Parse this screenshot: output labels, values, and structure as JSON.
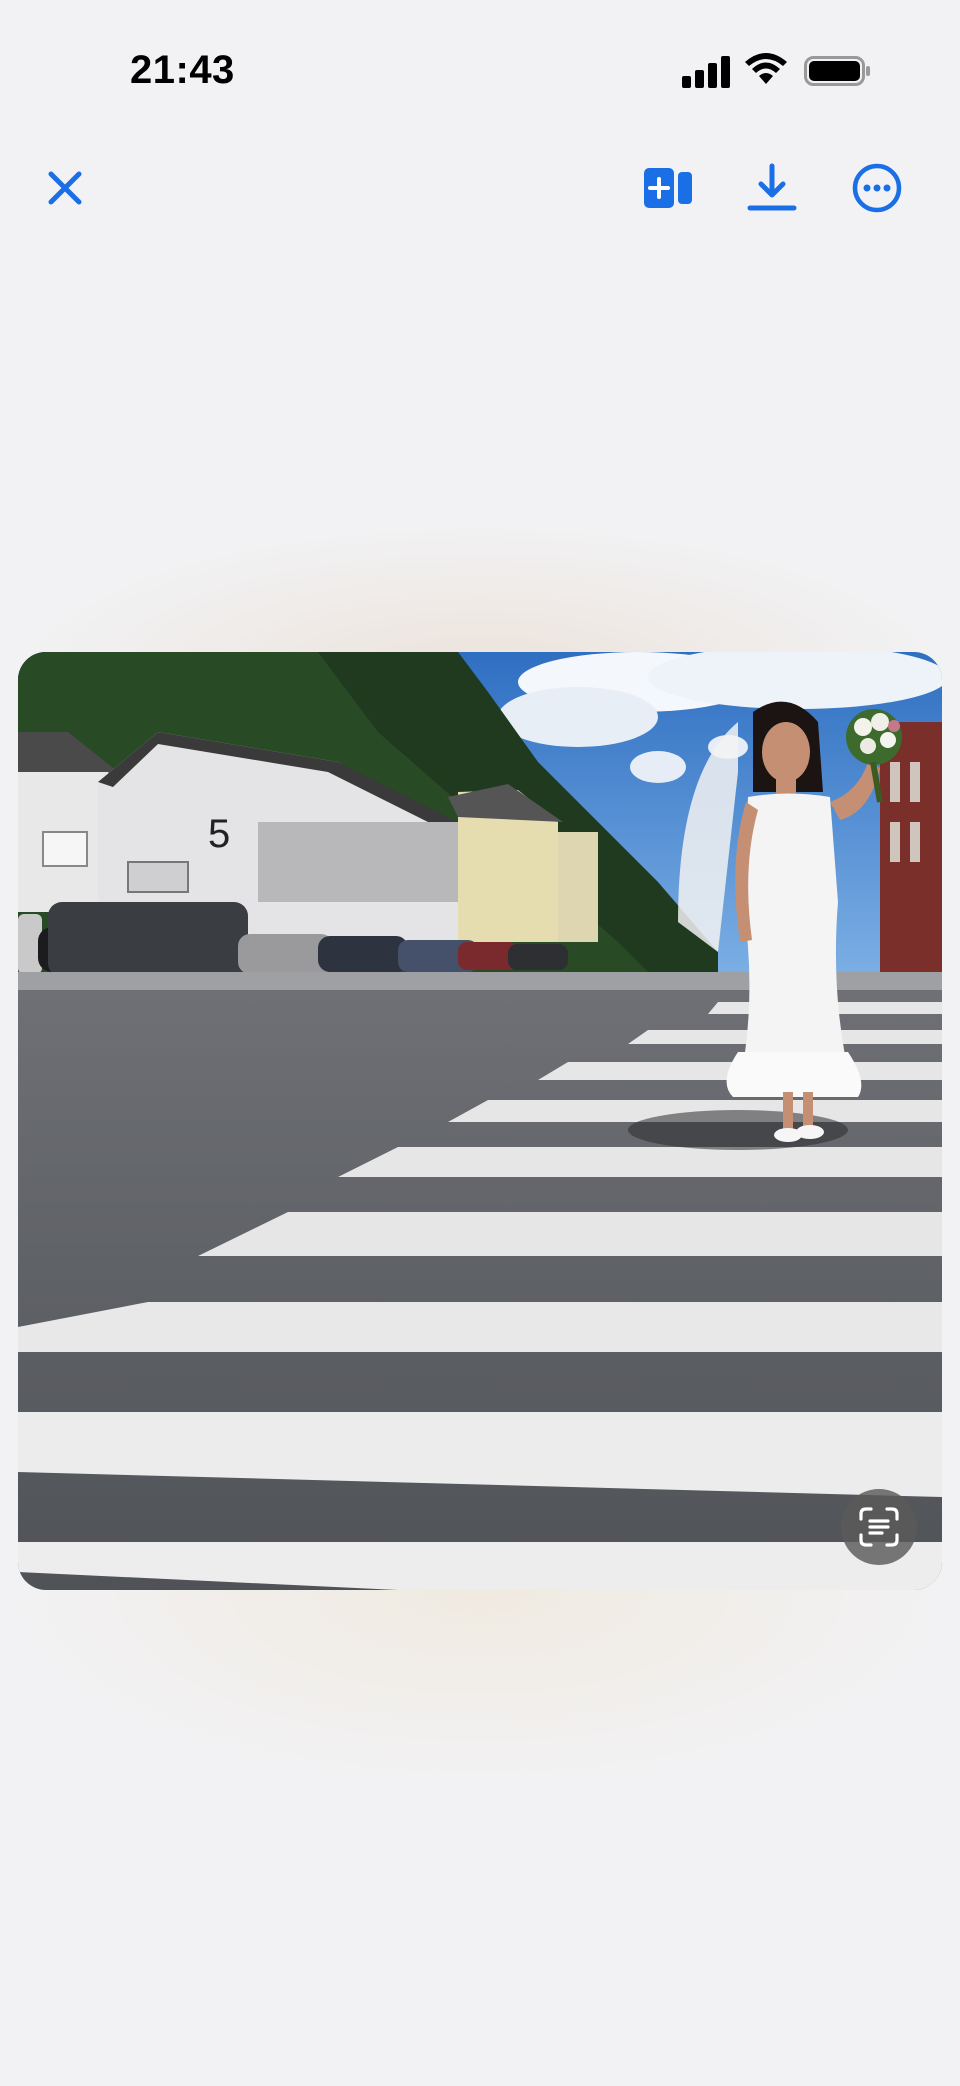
{
  "status_bar": {
    "time": "21:43"
  },
  "toolbar": {
    "close_icon": "close-icon",
    "add_to_board_icon": "add-to-board-icon",
    "download_icon": "download-icon",
    "more_icon": "more-icon"
  },
  "photo": {
    "building_number": "5"
  },
  "colors": {
    "accent": "#1a6ee6",
    "background": "#f2f2f4"
  }
}
